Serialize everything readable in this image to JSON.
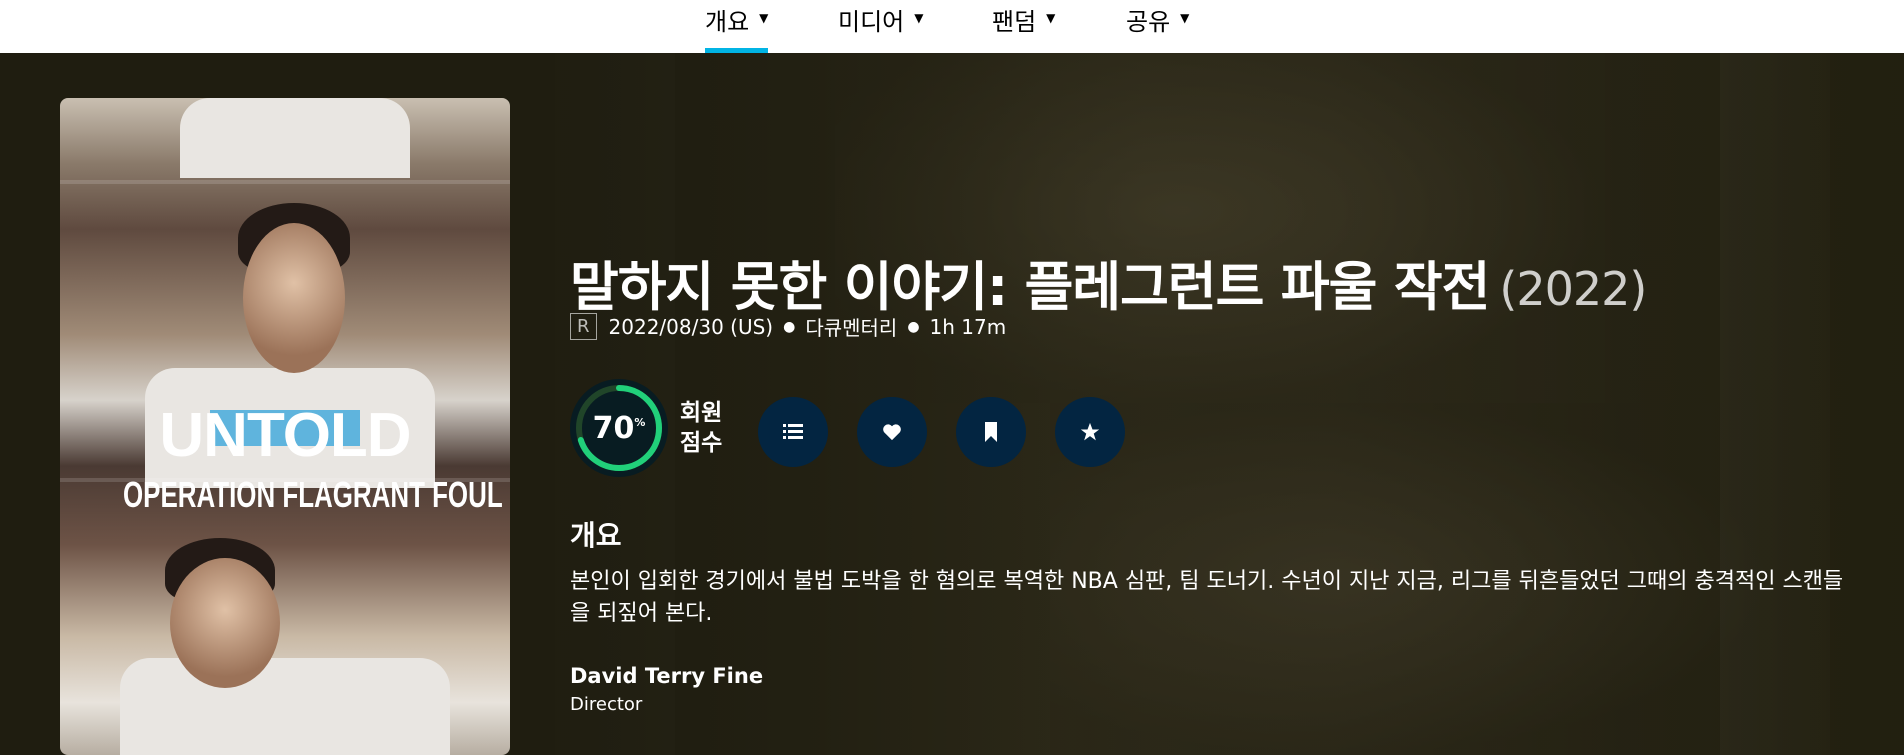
{
  "nav": {
    "items": [
      {
        "label": "개요",
        "active": true
      },
      {
        "label": "미디어",
        "active": false
      },
      {
        "label": "팬덤",
        "active": false
      },
      {
        "label": "공유",
        "active": false
      }
    ],
    "caret_icon": "caret-down-icon",
    "active_color": "#01b4e4"
  },
  "poster": {
    "title_line1": "UNTOLD",
    "title_line2": "OPERATION FLAGRANT FOUL"
  },
  "movie": {
    "title": "말하지 못한 이야기: 플레그런트 파울 작전",
    "year": "(2022)",
    "certification": "R",
    "release": "2022/08/30 (US)",
    "genre": "다큐멘터리",
    "runtime": "1h 17m"
  },
  "score": {
    "value": "70",
    "percent": 70,
    "unit": "%",
    "label": "회원\n점수",
    "ring_color": "#21d07a"
  },
  "actions": [
    {
      "name": "add-to-list-button",
      "icon": "list-icon"
    },
    {
      "name": "favorite-button",
      "icon": "heart-icon"
    },
    {
      "name": "watchlist-button",
      "icon": "bookmark-icon"
    },
    {
      "name": "rate-button",
      "icon": "star-icon"
    }
  ],
  "overview": {
    "heading": "개요",
    "text": "본인이 입회한 경기에서 불법 도박을 한 혐의로 복역한 NBA 심판, 팀 도너기. 수년이 지난 지금, 리그를 뒤흔들었던 그때의 충격적인 스캔들을 되짚어 본다."
  },
  "crew": [
    {
      "name": "David Terry Fine",
      "role": "Director"
    }
  ]
}
